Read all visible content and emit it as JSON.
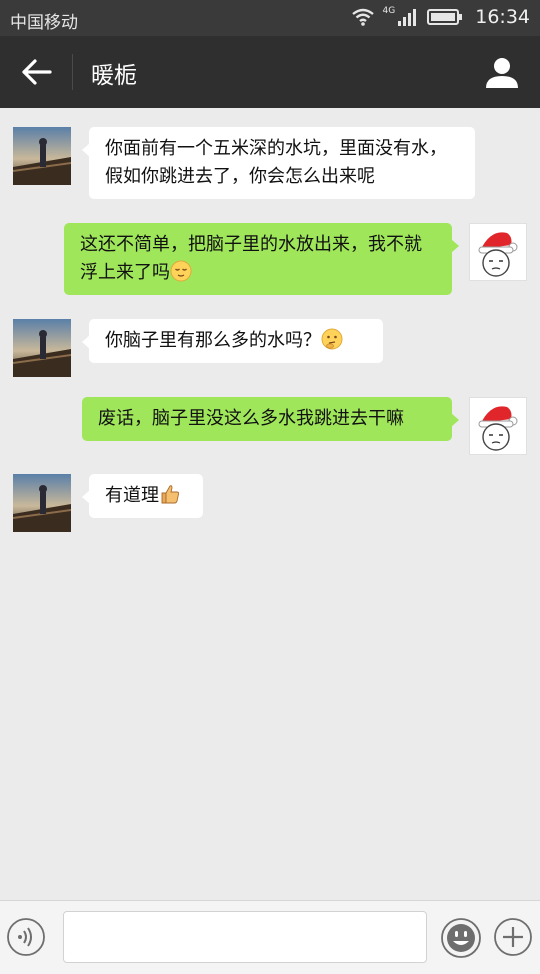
{
  "status_bar": {
    "carrier": "中国移动",
    "network_label": "4G",
    "time": "16:34"
  },
  "header": {
    "title": "暖栀",
    "back_icon": "arrow-left-icon",
    "profile_icon": "person-icon"
  },
  "messages": [
    {
      "side": "left",
      "text": "你面前有一个五米深的水坑，里面没有水，假如你跳进去了，你会怎么出来呢",
      "emoji": ""
    },
    {
      "side": "right",
      "text": "这还不简单，把脑子里的水放出来，我不就浮上来了吗",
      "emoji": "relieved-face"
    },
    {
      "side": "left",
      "text": "你脑子里有那么多的水吗？",
      "emoji": "thinking-face"
    },
    {
      "side": "right",
      "text": "废话，脑子里没这么多水我跳进去干嘛",
      "emoji": ""
    },
    {
      "side": "left",
      "text": "有道理",
      "emoji": "thumbs-up"
    }
  ],
  "input_bar": {
    "text_value": "",
    "voice_icon": "voice-icon",
    "emoji_icon": "smiley-icon",
    "plus_icon": "plus-icon"
  },
  "colors": {
    "status_bar": "#3a3a3a",
    "nav_bar": "#2f2f2f",
    "chat_background": "#ebebeb",
    "bubble_sent": "#9fe65a",
    "bubble_received": "#ffffff"
  }
}
